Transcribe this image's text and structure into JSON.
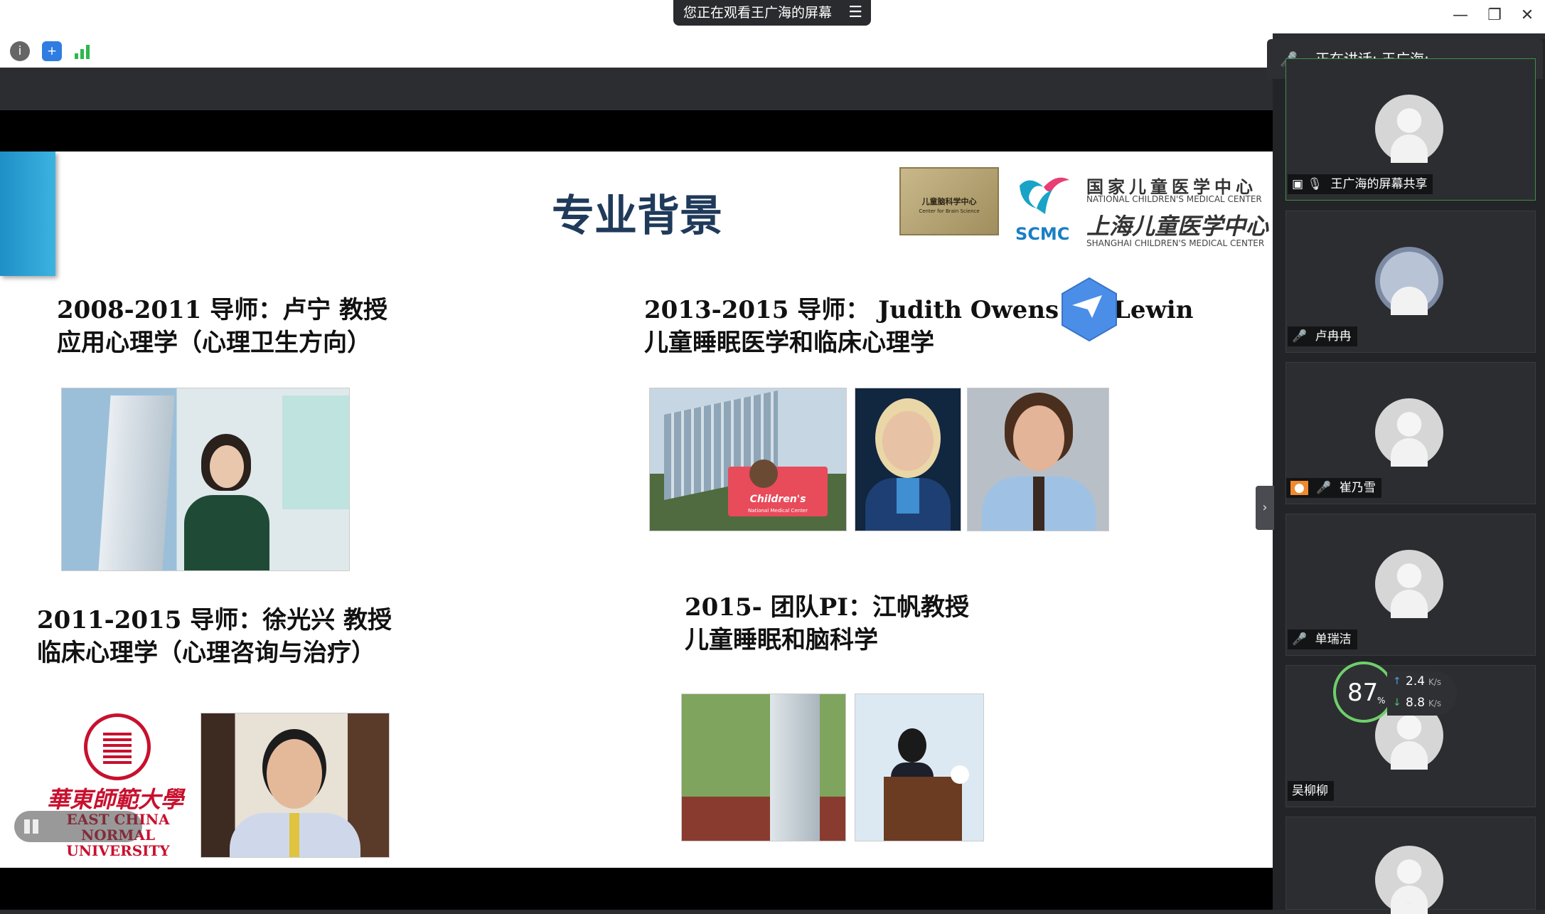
{
  "window": {
    "share_banner": "您正在观看王广海的屏幕",
    "menu_icon": "list-icon",
    "minimize_icon": "minimize-icon",
    "restore_icon": "restore-icon",
    "close_icon": "close-icon"
  },
  "toolbar": {
    "icons": [
      "info-icon",
      "shield-icon",
      "signal-icon"
    ]
  },
  "slide": {
    "title": "专业背景",
    "logo_center_text": "儿童脑科学中心",
    "logo_center_sub": "Center for Brain Science",
    "logo_scmc": "SCMC",
    "logo_ncmc_cn": "国家儿童医学中心",
    "logo_ncmc_en": "NATIONAL CHILDREN'S MEDICAL CENTER",
    "logo_shcmc_cn": "上海儿童医学中心",
    "logo_shcmc_en": "SHANGHAI CHILDREN'S MEDICAL CENTER",
    "block1_line1": "2008-2011 导师：卢宁 教授",
    "block1_line2": "应用心理学（心理卫生方向）",
    "block2_line1": "2013-2015 导师： Judith Owens   Da",
    "block2_line1b": "Lewin",
    "block2_line2": "儿童睡眠医学和临床心理学",
    "block3_line1": "2011-2015 导师：徐光兴 教授",
    "block3_line2": "临床心理学（心理咨询与治疗）",
    "block4_line1": "2015- 团队PI：江帆教授",
    "block4_line2": "儿童睡眠和脑科学",
    "ecnu_cn": "華東師範大學",
    "ecnu_en1": "EAST CHINA NORMAL",
    "ecnu_en2": "UNIVERSITY",
    "childrens_sign": "Children's",
    "childrens_sub": "National Medical Center"
  },
  "panel": {
    "speaking": "正在讲话: 王广海;",
    "tiles": [
      {
        "name": "王广海的屏幕共享",
        "mic": "mic-icon"
      },
      {
        "name": "卢冉冉",
        "mic": "mic-muted-icon"
      },
      {
        "name": "崔乃雪",
        "mic": "mic-muted-icon"
      },
      {
        "name": "单瑞洁",
        "mic": "mic-muted-icon"
      },
      {
        "name": "吴柳柳",
        "mic": ""
      }
    ],
    "network": {
      "percent": "87",
      "percent_unit": "%",
      "up": "2.4",
      "down": "8.8",
      "unit": "K/s"
    }
  }
}
